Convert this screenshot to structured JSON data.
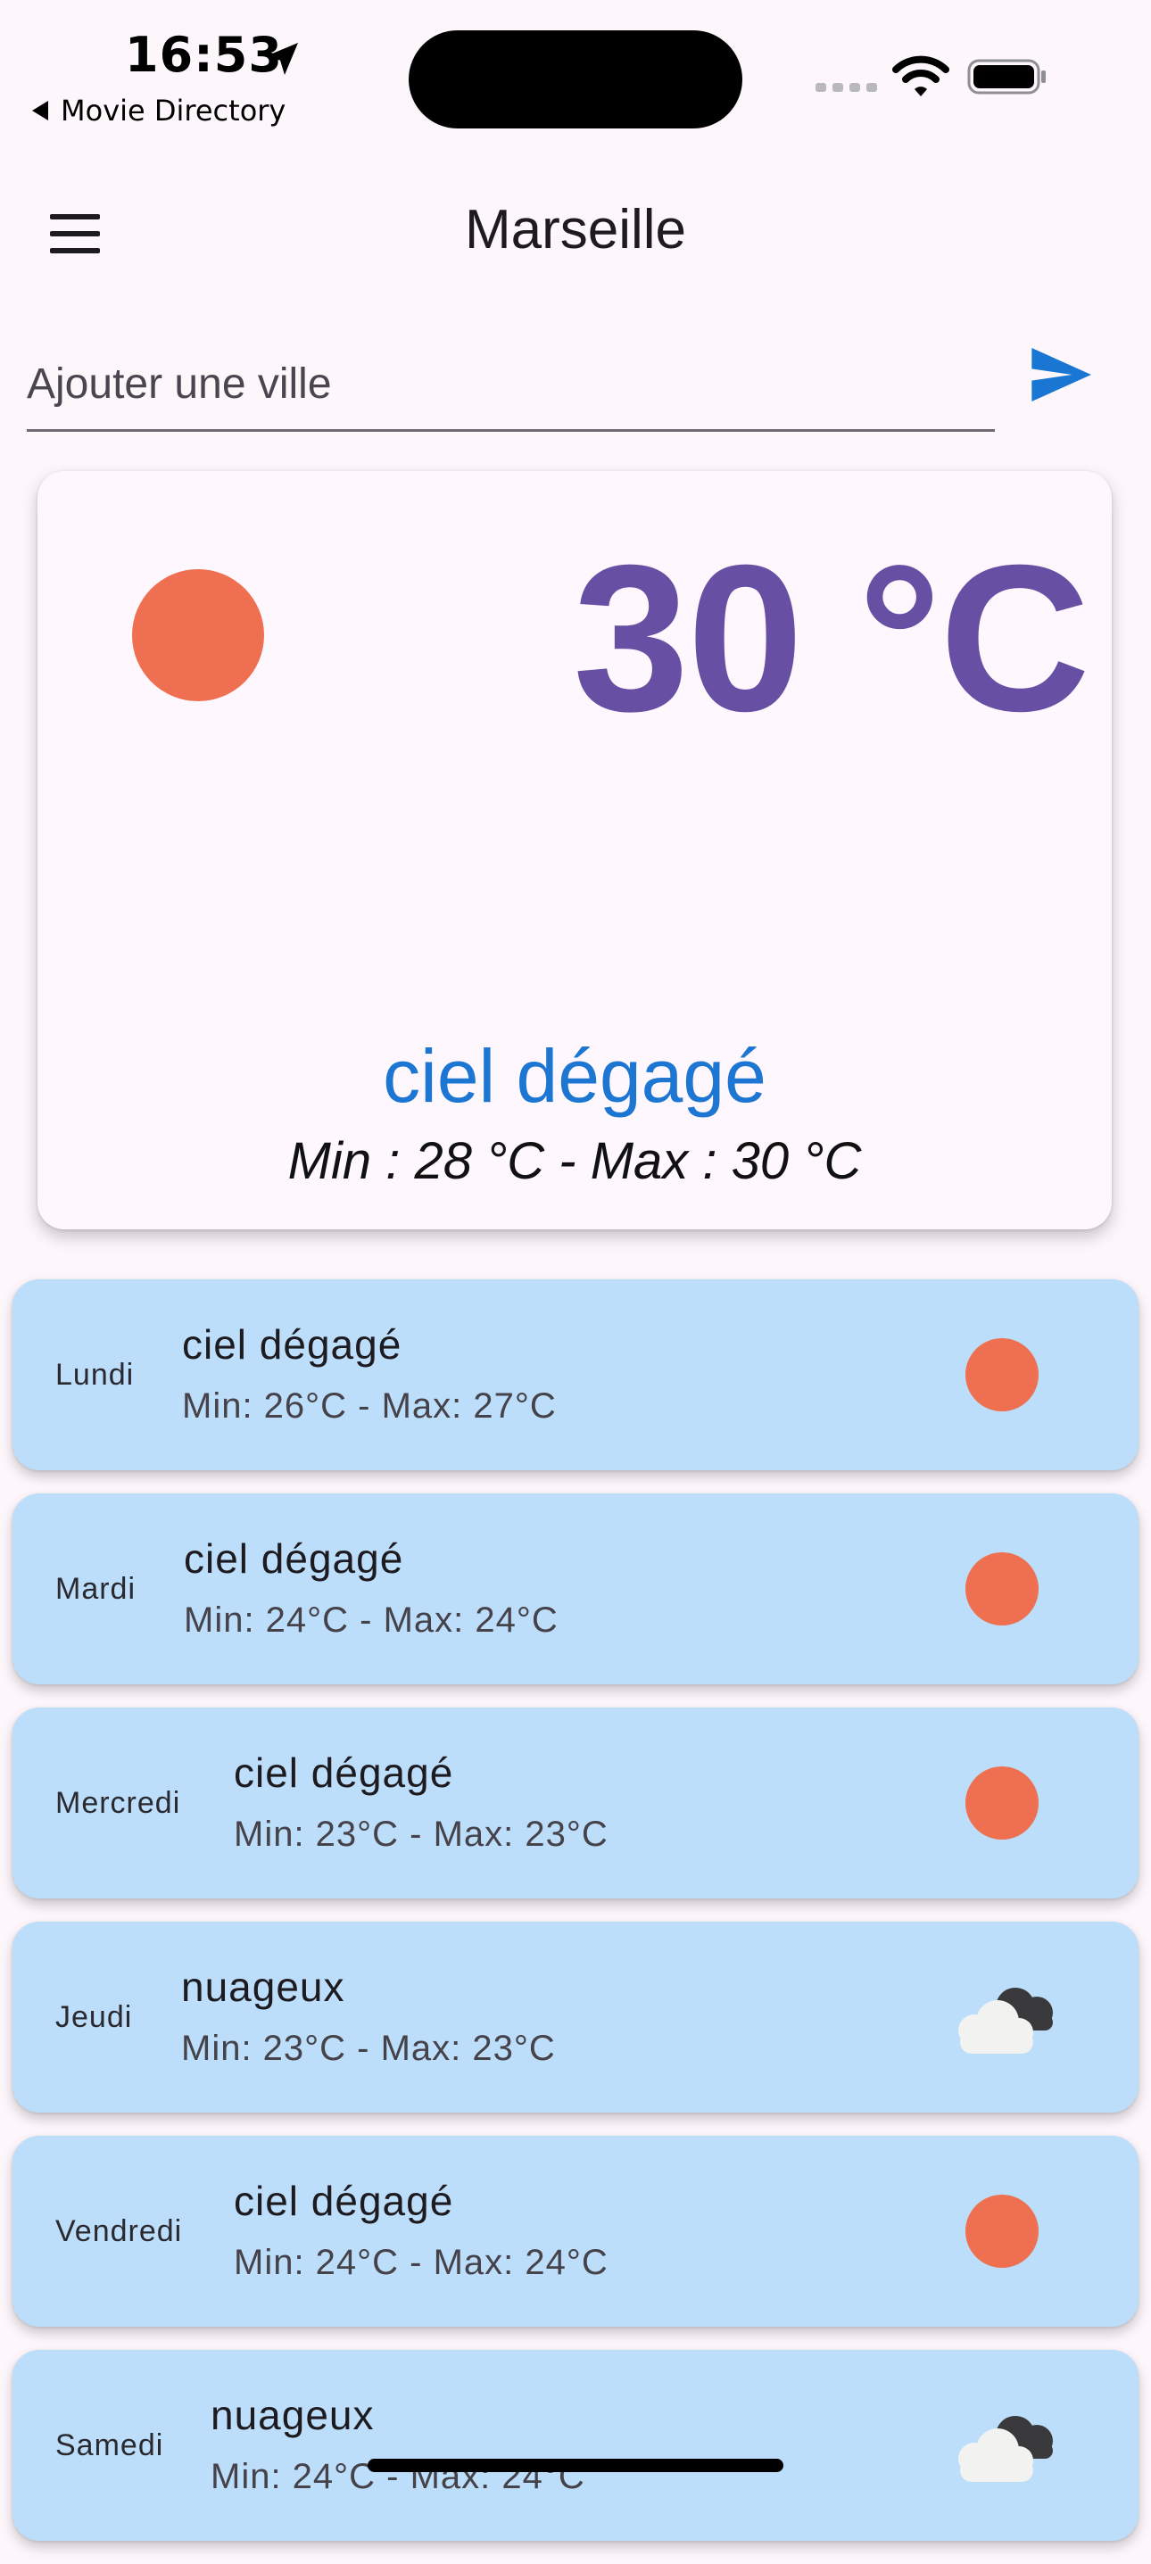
{
  "status_bar": {
    "time": "16:53",
    "back_label": "Movie Directory"
  },
  "app_bar": {
    "title": "Marseille",
    "menu_icon": "hamburger-menu-icon"
  },
  "search": {
    "placeholder": "Ajouter une ville",
    "value": "",
    "send_icon": "send-icon"
  },
  "current": {
    "temperature": "30 °C",
    "description": "ciel dégagé",
    "minmax": "Min : 28 °C - Max : 30 °C",
    "icon": "sun-icon"
  },
  "forecast": [
    {
      "day": "Lundi",
      "description": "ciel dégagé",
      "minmax": "Min: 26°C - Max: 27°C",
      "icon": "sun-icon"
    },
    {
      "day": "Mardi",
      "description": "ciel dégagé",
      "minmax": "Min: 24°C - Max: 24°C",
      "icon": "sun-icon"
    },
    {
      "day": "Mercredi",
      "description": "ciel dégagé",
      "minmax": "Min: 23°C - Max: 23°C",
      "icon": "sun-icon"
    },
    {
      "day": "Jeudi",
      "description": "nuageux",
      "minmax": "Min: 23°C - Max: 23°C",
      "icon": "cloud-icon"
    },
    {
      "day": "Vendredi",
      "description": "ciel dégagé",
      "minmax": "Min: 24°C - Max: 24°C",
      "icon": "sun-icon"
    },
    {
      "day": "Samedi",
      "description": "nuageux",
      "minmax": "Min: 24°C - Max: 24°C",
      "icon": "cloud-icon"
    }
  ],
  "colors": {
    "accent": "#6750a4",
    "description": "#1d76d1",
    "sun": "#ef6f51",
    "forecast_card": "#bcdefa",
    "send_button": "#1976d2"
  }
}
